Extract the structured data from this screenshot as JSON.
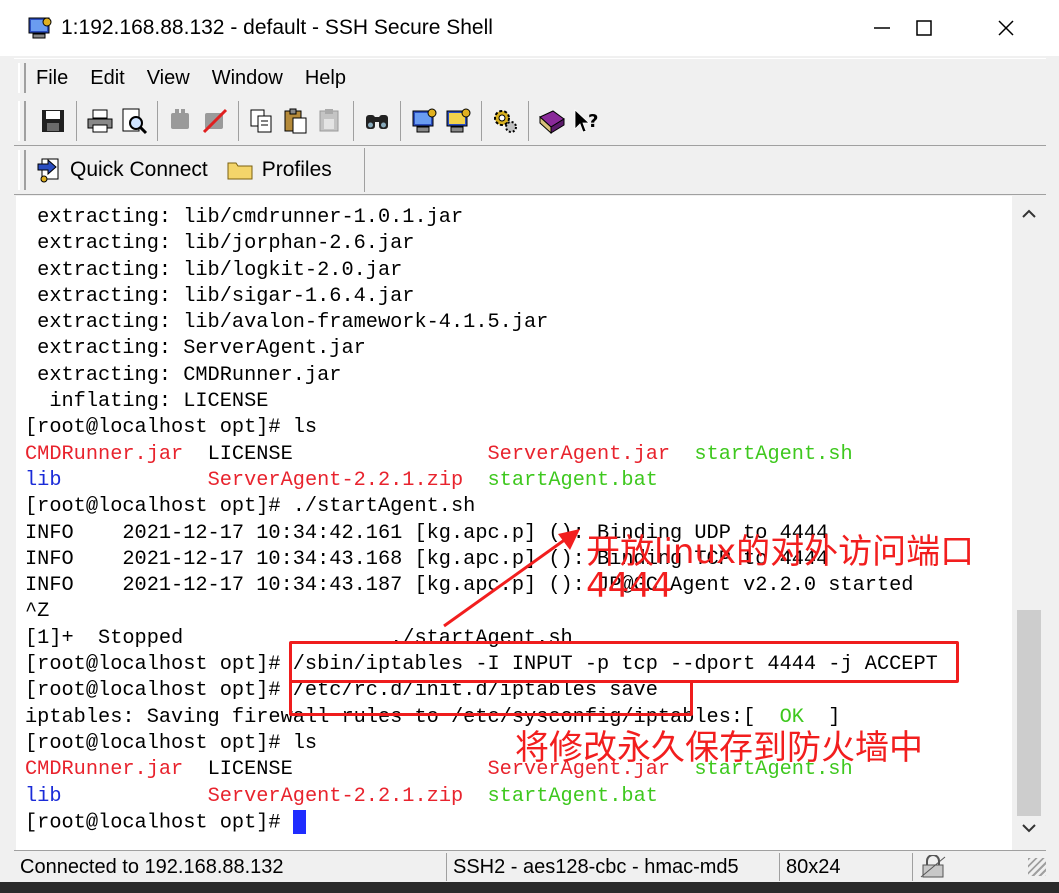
{
  "window": {
    "title": "1:192.168.88.132 - default - SSH Secure Shell"
  },
  "menu": [
    "File",
    "Edit",
    "View",
    "Window",
    "Help"
  ],
  "toolbar_icons": [
    "save-icon",
    "print-icon",
    "print-preview-icon",
    "disconnect-icon",
    "close-session-icon",
    "copy-icon",
    "paste-icon",
    "paste-disabled-icon",
    "find-icon",
    "new-terminal-icon",
    "new-file-transfer-icon",
    "settings-icon",
    "help-book-icon",
    "context-help-icon"
  ],
  "quickbar": {
    "quick_connect": "Quick Connect",
    "profiles": "Profiles"
  },
  "terminal": {
    "lines": [
      [
        {
          "t": " extracting: lib/cmdrunner-1.0.1.jar",
          "c": ""
        }
      ],
      [
        {
          "t": " extracting: lib/jorphan-2.6.jar",
          "c": ""
        }
      ],
      [
        {
          "t": " extracting: lib/logkit-2.0.jar",
          "c": ""
        }
      ],
      [
        {
          "t": " extracting: lib/sigar-1.6.4.jar",
          "c": ""
        }
      ],
      [
        {
          "t": " extracting: lib/avalon-framework-4.1.5.jar",
          "c": ""
        }
      ],
      [
        {
          "t": " extracting: ServerAgent.jar",
          "c": ""
        }
      ],
      [
        {
          "t": " extracting: CMDRunner.jar",
          "c": ""
        }
      ],
      [
        {
          "t": "  inflating: LICENSE",
          "c": ""
        }
      ],
      [
        {
          "t": "[root@localhost opt]# ls",
          "c": ""
        }
      ],
      [
        {
          "t": "CMDRunner.jar",
          "c": "red"
        },
        {
          "t": "  LICENSE                ",
          "c": ""
        },
        {
          "t": "ServerAgent.jar",
          "c": "red"
        },
        {
          "t": "  ",
          "c": ""
        },
        {
          "t": "startAgent.sh",
          "c": "green"
        }
      ],
      [
        {
          "t": "lib",
          "c": "blue"
        },
        {
          "t": "            ",
          "c": ""
        },
        {
          "t": "ServerAgent-2.2.1.zip",
          "c": "red"
        },
        {
          "t": "  ",
          "c": ""
        },
        {
          "t": "startAgent.bat",
          "c": "green"
        }
      ],
      [
        {
          "t": "[root@localhost opt]# ./startAgent.sh",
          "c": ""
        }
      ],
      [
        {
          "t": "INFO    2021-12-17 10:34:42.161 [kg.apc.p] (): Binding UDP to 4444",
          "c": ""
        }
      ],
      [
        {
          "t": "INFO    2021-12-17 10:34:43.168 [kg.apc.p] (): Binding TCP to 4444",
          "c": ""
        }
      ],
      [
        {
          "t": "INFO    2021-12-17 10:34:43.187 [kg.apc.p] (): JP@GC Agent v2.2.0 started",
          "c": ""
        }
      ],
      [
        {
          "t": "^Z",
          "c": ""
        }
      ],
      [
        {
          "t": "[1]+  Stopped                 ./startAgent.sh",
          "c": ""
        }
      ],
      [
        {
          "t": "[root@localhost opt]# /sbin/iptables -I INPUT -p tcp --dport 4444 -j ACCEPT",
          "c": ""
        }
      ],
      [
        {
          "t": "[root@localhost opt]# /etc/rc.d/init.d/iptables save",
          "c": ""
        }
      ],
      [
        {
          "t": "iptables: Saving firewall rules to /etc/sysconfig/iptables:[  ",
          "c": ""
        },
        {
          "t": "OK",
          "c": "green"
        },
        {
          "t": "  ]",
          "c": ""
        }
      ],
      [
        {
          "t": "[root@localhost opt]# ls",
          "c": ""
        }
      ],
      [
        {
          "t": "CMDRunner.jar",
          "c": "red"
        },
        {
          "t": "  LICENSE                ",
          "c": ""
        },
        {
          "t": "ServerAgent.jar",
          "c": "red"
        },
        {
          "t": "  ",
          "c": ""
        },
        {
          "t": "startAgent.sh",
          "c": "green"
        }
      ],
      [
        {
          "t": "lib",
          "c": "blue"
        },
        {
          "t": "            ",
          "c": ""
        },
        {
          "t": "ServerAgent-2.2.1.zip",
          "c": "red"
        },
        {
          "t": "  ",
          "c": ""
        },
        {
          "t": "startAgent.bat",
          "c": "green"
        }
      ],
      [
        {
          "t": "[root@localhost opt]# ",
          "c": ""
        },
        {
          "t": "",
          "c": "cursor"
        }
      ]
    ]
  },
  "annotations": {
    "note1_line1": "开放linux的对外访问端口",
    "note1_line2": "4444",
    "note2": "将修改永久保存到防火墙中"
  },
  "status": {
    "connection": "Connected to 192.168.88.132",
    "cipher": "SSH2 - aes128-cbc - hmac-md5",
    "size": "80x24"
  },
  "colors": {
    "error_red": "#e8232d",
    "dir_blue": "#1a2bd8",
    "exec_green": "#3ec81e",
    "annotation_red": "#f21e1e"
  }
}
